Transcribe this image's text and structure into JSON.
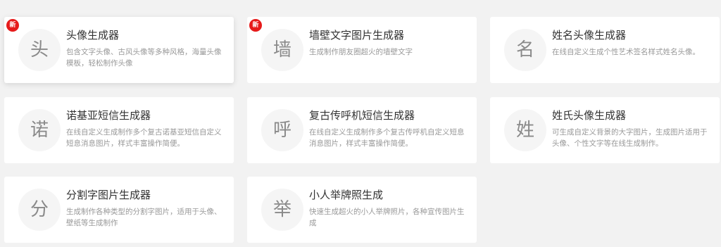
{
  "new_badge_label": "新",
  "accent_color": "#e61a1a",
  "cards": [
    {
      "icon_char": "头",
      "title": "头像生成器",
      "desc": "包含文字头像、古风头像等多种风格，海量头像模板，轻松制作头像",
      "is_new": true
    },
    {
      "icon_char": "墙",
      "title": "墙壁文字图片生成器",
      "desc": "生成制作朋友圈超火的墙壁文字",
      "is_new": true
    },
    {
      "icon_char": "名",
      "title": "姓名头像生成器",
      "desc": "在线自定义生成个性艺术签名样式姓名头像。",
      "is_new": false
    },
    {
      "icon_char": "诺",
      "title": "诺基亚短信生成器",
      "desc": "在线自定义生成制作多个复古诺基亚短信自定义短息消息图片，样式丰富操作简便。",
      "is_new": false
    },
    {
      "icon_char": "呼",
      "title": "复古传呼机短信生成器",
      "desc": "在线自定义生成制作多个复古传呼机自定义短息消息图片，样式丰富操作简便。",
      "is_new": false
    },
    {
      "icon_char": "姓",
      "title": "姓氏头像生成器",
      "desc": "可生成自定义背景的大字图片，生成图片适用于头像、个性文字等在线生成制作。",
      "is_new": false
    },
    {
      "icon_char": "分",
      "title": "分割字图片生成器",
      "desc": "生成制作各种类型的分割字图片，适用于头像、壁纸等生成制作",
      "is_new": false
    },
    {
      "icon_char": "举",
      "title": "小人举牌照生成",
      "desc": "快速生成超火的小人举牌照片，各种宣传图片生成",
      "is_new": false
    }
  ]
}
